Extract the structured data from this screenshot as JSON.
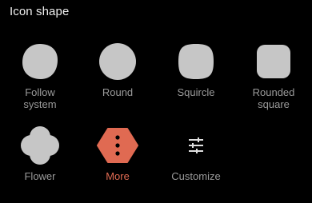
{
  "header": {
    "title": "Icon shape"
  },
  "options": [
    {
      "name": "follow-system",
      "line1": "Follow",
      "line2": "system",
      "icon": "blob-shape-icon"
    },
    {
      "name": "round",
      "line1": "Round",
      "line2": "",
      "icon": "circle-shape-icon"
    },
    {
      "name": "squircle",
      "line1": "Squircle",
      "line2": "",
      "icon": "squircle-shape-icon"
    },
    {
      "name": "rounded-square",
      "line1": "Rounded",
      "line2": "square",
      "icon": "rounded-square-shape-icon"
    },
    {
      "name": "flower",
      "line1": "Flower",
      "line2": "",
      "icon": "flower-shape-icon"
    },
    {
      "name": "more",
      "line1": "More",
      "line2": "",
      "icon": "more-vertical-icon"
    },
    {
      "name": "customize",
      "line1": "Customize",
      "line2": "",
      "icon": "sliders-icon"
    }
  ],
  "colors": {
    "background": "#000000",
    "shape_fill": "#c6c6c6",
    "label": "#9a9a9a",
    "accent": "#e06a52"
  }
}
